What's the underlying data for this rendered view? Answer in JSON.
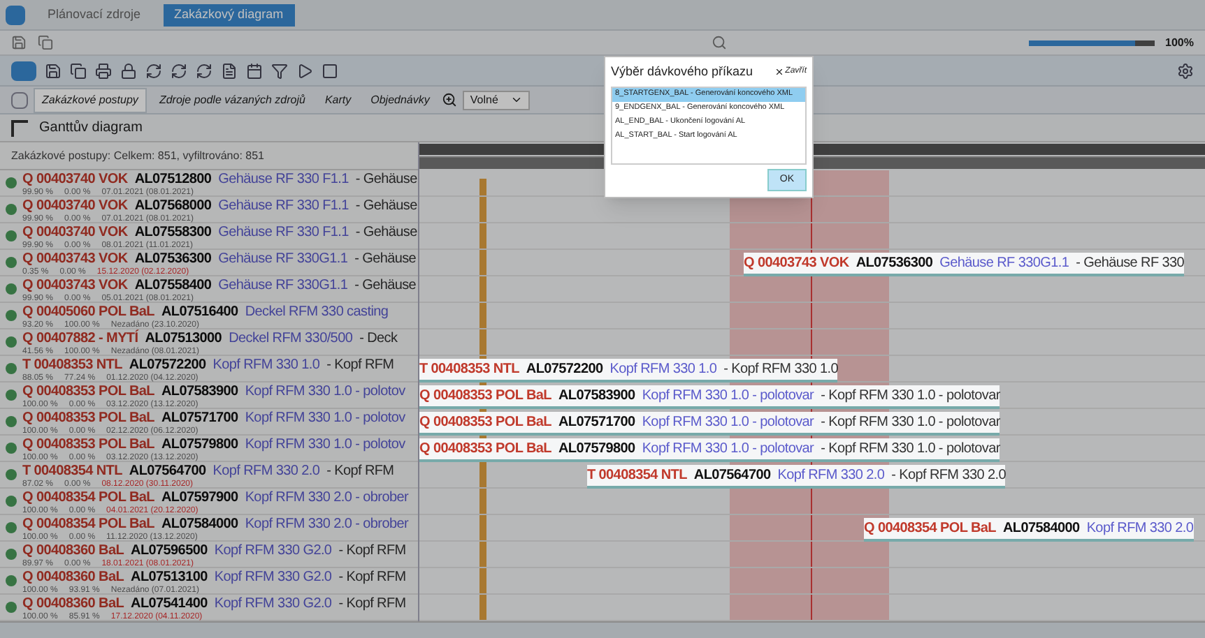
{
  "window": {
    "tabs": [
      {
        "label": "Plánovací zdroje",
        "selected": false
      },
      {
        "label": "Zakázkový diagram",
        "selected": true
      }
    ],
    "zoom": "100%",
    "level": 0.85
  },
  "view_tabs": [
    {
      "label": "Zakázkové postupy",
      "selected": true
    },
    {
      "label": "Zdroje podle vázaných zdrojů",
      "selected": false
    },
    {
      "label": "Karty",
      "selected": false
    },
    {
      "label": "Objednávky",
      "selected": false
    }
  ],
  "zoom_select": "Volné",
  "panel": {
    "title": "Ganttův diagram",
    "summary": "Zakázkové postupy: Celkem: 851, vyfiltrováno: 851"
  },
  "rows": [
    {
      "prefix": "Q 00403740 VOK",
      "code": "AL07512800",
      "name": "Gehäuse RF 330 F1.1",
      "rest": "- Gehäuse",
      "pct1": "99.90 %",
      "pct2": "0.00 %",
      "date": "07.01.2021 (08.01.2021)",
      "late": false
    },
    {
      "prefix": "Q 00403740 VOK",
      "code": "AL07568000",
      "name": "Gehäuse RF 330 F1.1",
      "rest": "- Gehäuse",
      "pct1": "99.90 %",
      "pct2": "0.00 %",
      "date": "07.01.2021 (08.01.2021)",
      "late": false
    },
    {
      "prefix": "Q 00403740 VOK",
      "code": "AL07558300",
      "name": "Gehäuse RF 330 F1.1",
      "rest": "- Gehäuse",
      "pct1": "99.90 %",
      "pct2": "0.00 %",
      "date": "08.01.2021 (11.01.2021)",
      "late": false
    },
    {
      "prefix": "Q 00403743 VOK",
      "code": "AL07536300",
      "name": "Gehäuse RF 330G1.1",
      "rest": "- Gehäuse",
      "pct1": "0.35 %",
      "pct2": "0.00 %",
      "date": "15.12.2020 (02.12.2020)",
      "late": true,
      "bar": {
        "prefix": "Q 00403743 VOK",
        "code": "AL07536300",
        "name": "Gehäuse RF 330G1.1",
        "rest": "- Gehäuse RF 330"
      }
    },
    {
      "prefix": "Q 00403743 VOK",
      "code": "AL07558400",
      "name": "Gehäuse RF 330G1.1",
      "rest": "- Gehäuse",
      "pct1": "99.90 %",
      "pct2": "0.00 %",
      "date": "05.01.2021 (08.01.2021)",
      "late": false
    },
    {
      "prefix": "Q 00405060 POL BaL",
      "code": "AL07516400",
      "name": "Deckel RFM 330 casting",
      "pct1": "93.20 %",
      "pct2": "100.00 %",
      "date": "Nezadáno (23.10.2020)",
      "late": false
    },
    {
      "prefix": "Q 00407882 - MYTÍ",
      "code": "AL07513000",
      "name": "Deckel RFM 330/500",
      "rest": "- Deck",
      "pct1": "41.56 %",
      "pct2": "100.00 %",
      "date": "Nezadáno (08.01.2021)",
      "late": false
    },
    {
      "prefix": "T 00408353 NTL",
      "code": "AL07572200",
      "name": "Kopf RFM 330 1.0",
      "rest": "- Kopf RFM",
      "pct1": "88.05 %",
      "pct2": "77.24 %",
      "date": "01.12.2020 (04.12.2020)",
      "late": false,
      "bar": {
        "prefix": "T 00408353 NTL",
        "code": "AL07572200",
        "name": "Kopf RFM 330 1.0",
        "rest": "- Kopf RFM 330 1.0"
      }
    },
    {
      "prefix": "Q 00408353 POL BaL",
      "code": "AL07583900",
      "name": "Kopf RFM 330 1.0 - polotov",
      "pct1": "100.00 %",
      "pct2": "0.00 %",
      "date": "03.12.2020 (13.12.2020)",
      "late": false,
      "bar": {
        "prefix": "Q 00408353 POL BaL",
        "code": "AL07583900",
        "name": "Kopf RFM 330 1.0 - polotovar",
        "rest": "- Kopf RFM 330 1.0 - polotovar"
      }
    },
    {
      "prefix": "Q 00408353 POL BaL",
      "code": "AL07571700",
      "name": "Kopf RFM 330 1.0 - polotov",
      "pct1": "100.00 %",
      "pct2": "0.00 %",
      "date": "02.12.2020 (06.12.2020)",
      "late": false,
      "bar": {
        "prefix": "Q 00408353 POL BaL",
        "code": "AL07571700",
        "name": "Kopf RFM 330 1.0 - polotovar",
        "rest": "- Kopf RFM 330 1.0 - polotovar"
      }
    },
    {
      "prefix": "Q 00408353 POL BaL",
      "code": "AL07579800",
      "name": "Kopf RFM 330 1.0 - polotov",
      "pct1": "100.00 %",
      "pct2": "0.00 %",
      "date": "03.12.2020 (13.12.2020)",
      "late": false,
      "bar": {
        "prefix": "Q 00408353 POL BaL",
        "code": "AL07579800",
        "name": "Kopf RFM 330 1.0 - polotovar",
        "rest": "- Kopf RFM 330 1.0 - polotovar"
      }
    },
    {
      "prefix": "T 00408354 NTL",
      "code": "AL07564700",
      "name": "Kopf RFM 330 2.0",
      "rest": "- Kopf RFM",
      "pct1": "87.02 %",
      "pct2": "0.00 %",
      "date": "08.12.2020 (30.11.2020)",
      "late": true,
      "bar": {
        "prefix": "T 00408354 NTL",
        "code": "AL07564700",
        "name": "Kopf RFM 330 2.0",
        "rest": "- Kopf RFM 330 2.0"
      }
    },
    {
      "prefix": "Q 00408354 POL BaL",
      "code": "AL07597900",
      "name": "Kopf RFM 330 2.0 - obrober",
      "pct1": "100.00 %",
      "pct2": "0.00 %",
      "date": "04.01.2021 (20.12.2020)",
      "late": true
    },
    {
      "prefix": "Q 00408354 POL BaL",
      "code": "AL07584000",
      "name": "Kopf RFM 330 2.0 - obrober",
      "pct1": "100.00 %",
      "pct2": "0.00 %",
      "date": "11.12.2020 (13.12.2020)",
      "late": false,
      "bar": {
        "prefix": "Q 00408354 POL BaL",
        "code": "AL07584000",
        "name": "Kopf RFM 330 2.0"
      }
    },
    {
      "prefix": "Q 00408360 BaL",
      "code": "AL07596500",
      "name": "Kopf RFM 330 G2.0",
      "rest": "- Kopf RFM",
      "pct1": "89.97 %",
      "pct2": "0.00 %",
      "date": "18.01.2021 (08.01.2021)",
      "late": true
    },
    {
      "prefix": "Q 00408360 BaL",
      "code": "AL07513100",
      "name": "Kopf RFM 330 G2.0",
      "rest": "- Kopf RFM",
      "pct1": "100.00 %",
      "pct2": "93.91 %",
      "date": "Nezadáno (07.01.2021)",
      "late": false
    },
    {
      "prefix": "Q 00408360 BaL",
      "code": "AL07541400",
      "name": "Kopf RFM 330 G2.0",
      "rest": "- Kopf RFM",
      "pct1": "100.00 %",
      "pct2": "85.91 %",
      "date": "17.12.2020 (04.11.2020)",
      "late": true
    }
  ],
  "dialog": {
    "title": "Výběr dávkového příkazu",
    "close": "Zavřít",
    "items": [
      {
        "label": "8_STARTGENX_BAL - Generování koncového XML",
        "selected": true
      },
      {
        "label": "9_ENDGENX_BAL - Generování koncového XML",
        "selected": false
      },
      {
        "label": "AL_END_BAL - Ukončení logování AL",
        "selected": false
      },
      {
        "label": "AL_START_BAL - Start logování AL",
        "selected": false
      }
    ],
    "ok": "OK"
  }
}
